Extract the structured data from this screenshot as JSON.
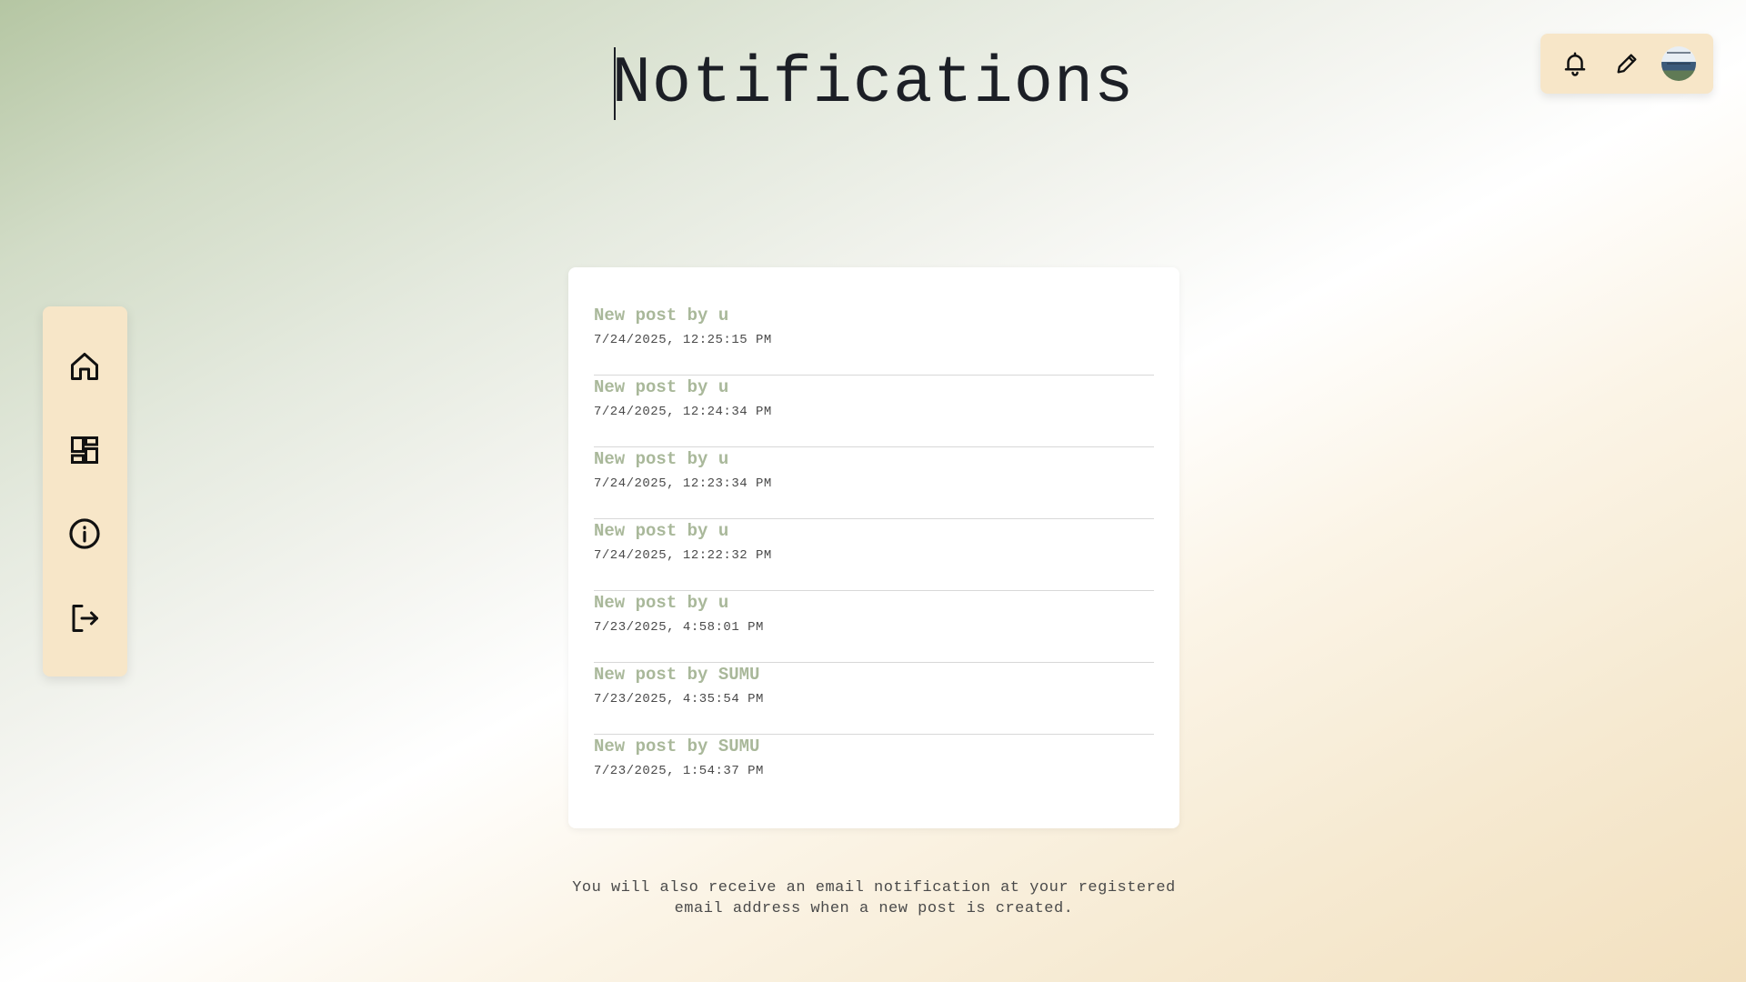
{
  "header": {
    "title": "Notifications"
  },
  "toolbar": {
    "icons": [
      "bell-icon",
      "pencil-icon",
      "user-avatar"
    ]
  },
  "sidebar": {
    "items": [
      {
        "icon": "home-icon"
      },
      {
        "icon": "dashboard-icon"
      },
      {
        "icon": "info-icon"
      },
      {
        "icon": "logout-icon"
      }
    ]
  },
  "notifications": [
    {
      "title": "New post by u",
      "time": "7/24/2025, 12:25:15 PM"
    },
    {
      "title": "New post by u",
      "time": "7/24/2025, 12:24:34 PM"
    },
    {
      "title": "New post by u",
      "time": "7/24/2025, 12:23:34 PM"
    },
    {
      "title": "New post by u",
      "time": "7/24/2025, 12:22:32 PM"
    },
    {
      "title": "New post by u",
      "time": "7/23/2025, 4:58:01 PM"
    },
    {
      "title": "New post by SUMU",
      "time": "7/23/2025, 4:35:54 PM"
    },
    {
      "title": "New post by SUMU",
      "time": "7/23/2025, 1:54:37 PM"
    }
  ],
  "footer": {
    "info": "You will also receive an email notification at your registered email address when a new post is created."
  },
  "colors": {
    "panel": "#f7e6c8",
    "title_accent": "#a9b89a",
    "text": "#1c1f26"
  }
}
